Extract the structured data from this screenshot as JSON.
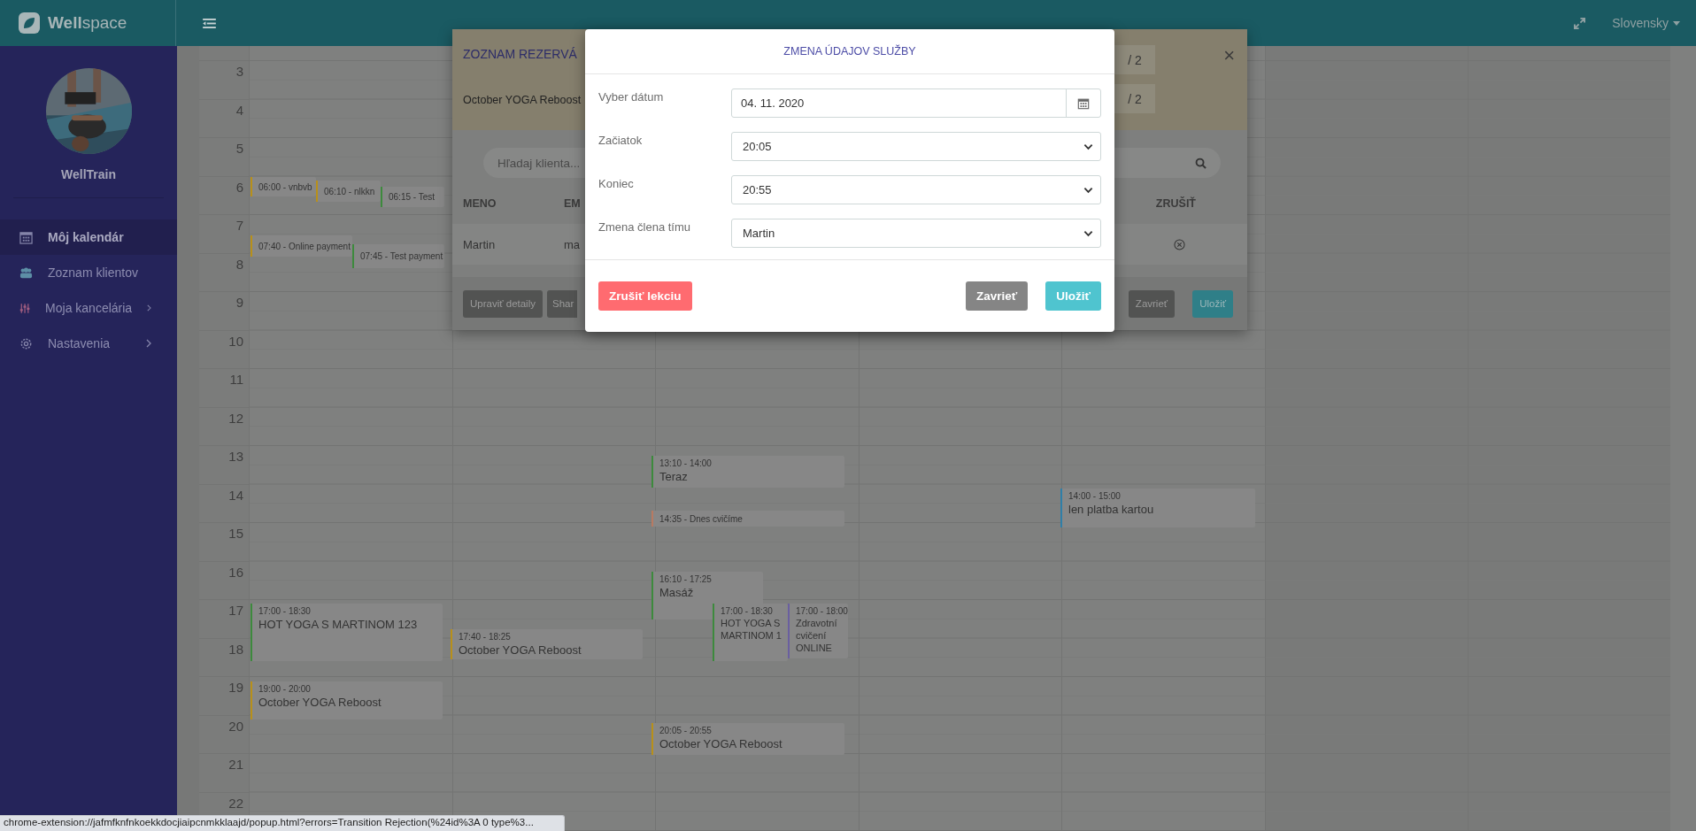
{
  "topbar": {
    "logo": "**Well**space",
    "language": "Slovensky"
  },
  "sidebar": {
    "user_name": "WellTrain",
    "items": [
      {
        "label": "Môj kalendár",
        "selected": true,
        "has_submenu": false
      },
      {
        "label": "Zoznam klientov",
        "selected": false,
        "has_submenu": false
      },
      {
        "label": "Moja kancelária",
        "selected": false,
        "has_submenu": true
      },
      {
        "label": "Nastavenia",
        "selected": false,
        "has_submenu": true
      }
    ]
  },
  "calendar": {
    "hours": [
      "3",
      "4",
      "5",
      "6",
      "7",
      "8",
      "9",
      "10",
      "11",
      "12",
      "13",
      "14",
      "15",
      "16",
      "17",
      "18",
      "19",
      "20",
      "21",
      "22"
    ],
    "events": [
      {
        "kind": "compact",
        "text": "06:00 - vnbvb",
        "color": "#b8901a"
      },
      {
        "kind": "compact",
        "text": "06:10 - nlkkn",
        "color": "#b8901a"
      },
      {
        "kind": "compact",
        "text": "06:15 - Test",
        "color": "#3d8a3d"
      },
      {
        "kind": "compact",
        "text": "07:40 - Online payment",
        "color": "#b8901a"
      },
      {
        "kind": "compact",
        "text": "07:45 - Test payment",
        "color": "#3d8a3d"
      },
      {
        "kind": "block",
        "time": "17:00 - 18:30",
        "title": "HOT YOGA S MARTINOM 123",
        "color": "#3d8a3d"
      },
      {
        "kind": "block",
        "time": "19:00 - 20:00",
        "title": "October YOGA Reboost",
        "color": "#b8901a"
      },
      {
        "kind": "block",
        "time": "17:40 - 18:25",
        "title": "October YOGA Reboost",
        "color": "#b8901a"
      },
      {
        "kind": "block",
        "time": "13:10 - 14:00",
        "title": "Teraz",
        "color": "#3d8a3d"
      },
      {
        "kind": "compact",
        "text": "14:35 - Dnes cvičíme",
        "color": "#b87a62"
      },
      {
        "kind": "block",
        "time": "16:10 - 17:25",
        "title": "Masáž",
        "color": "#3d8a3d"
      },
      {
        "kind": "block",
        "time": "17:00 - 18:30",
        "title": "HOT YOGA S MARTINOM 1",
        "color": "#3d8a3d"
      },
      {
        "kind": "block",
        "time": "17:00 - 18:00",
        "title": "Zdravotní cvičení ONLINE",
        "color": "#6a5fa0"
      },
      {
        "kind": "block",
        "time": "20:05 - 20:55",
        "title": "October YOGA Reboost",
        "color": "#b8901a"
      },
      {
        "kind": "block",
        "time": "14:00 - 15:00",
        "title": "len platba kartou",
        "color": "#2f7fa8"
      }
    ]
  },
  "reservations_dialog": {
    "title": "ZOZNAM REZERVÁ",
    "service": "October YOGA Reboost",
    "capacity": [
      "/ 2",
      "/ 2"
    ],
    "close": "×",
    "search_placeholder": "Hľadaj klienta...",
    "columns": [
      "MENO",
      "EM",
      "ZRUŠIŤ"
    ],
    "rows": [
      {
        "cells": [
          "Martin",
          "ma"
        ]
      }
    ],
    "buttons": [
      {
        "label": "Upraviť detaily",
        "kind": "dark"
      },
      {
        "label": "Shar",
        "kind": "dark"
      },
      {
        "label": "Zavrieť",
        "kind": "dark"
      },
      {
        "label": "Uložiť",
        "kind": "primary"
      }
    ]
  },
  "edit_dialog": {
    "title": "ZMENA ÚDAJOV SLUŽBY",
    "fields": [
      {
        "label": "Vyber dátum",
        "kind": "date",
        "value": "04. 11. 2020"
      },
      {
        "label": "Začiatok",
        "kind": "select",
        "value": "20:05"
      },
      {
        "label": "Koniec",
        "kind": "select",
        "value": "20:55"
      },
      {
        "label": "Zmena člena tímu",
        "kind": "select",
        "value": "Martin"
      }
    ],
    "buttons": [
      {
        "label": "Zrušiť lekciu",
        "kind": "danger"
      },
      {
        "label": "Zavrieť",
        "kind": "secondary"
      },
      {
        "label": "Uložiť",
        "kind": "primary"
      }
    ]
  },
  "status_bar": {
    "url": "chrome-extension://jafmfknfnkoekkdocjiaipcnmkklaajd/popup.html?errors=Transition Rejection(%24id%3A 0 type%3..."
  }
}
